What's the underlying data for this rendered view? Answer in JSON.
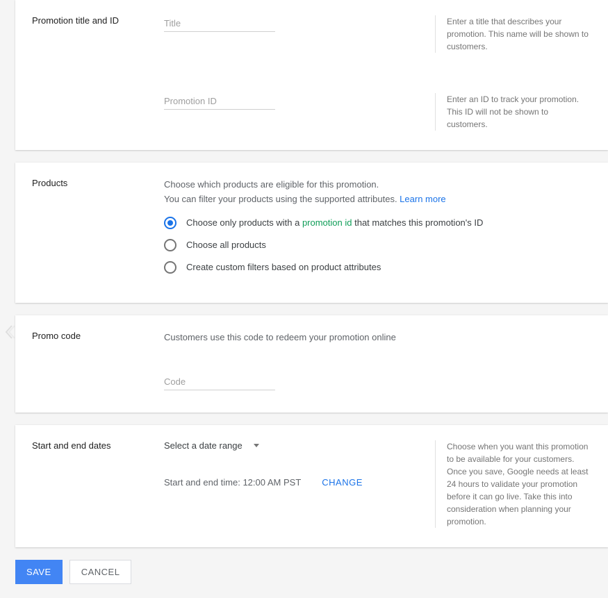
{
  "title_section": {
    "label": "Promotion title and ID",
    "title_placeholder": "Title",
    "title_help": "Enter a title that describes your promotion. This name will be shown to customers.",
    "id_placeholder": "Promotion ID",
    "id_help": "Enter an ID to track your promotion. This ID will not be shown to customers."
  },
  "products_section": {
    "label": "Products",
    "desc_line1": "Choose which products are eligible for this promotion.",
    "desc_line2_a": "You can filter your products using the supported attributes. ",
    "learn_more": "Learn more",
    "options": [
      {
        "label_before": "Choose only products with a ",
        "green": "promotion id",
        "label_after": " that matches this promotion's ID",
        "checked": true
      },
      {
        "label_before": "Choose all products",
        "green": "",
        "label_after": "",
        "checked": false
      },
      {
        "label_before": "Create custom filters based on product attributes",
        "green": "",
        "label_after": "",
        "checked": false
      }
    ]
  },
  "promo_section": {
    "label": "Promo code",
    "desc": "Customers use this code to redeem your promotion online",
    "code_placeholder": "Code"
  },
  "dates_section": {
    "label": "Start and end dates",
    "select_label": "Select a date range",
    "time_label": "Start and end time: ",
    "time_value": "12:00 AM PST",
    "change": "CHANGE",
    "help": "Choose when you want this promotion to be available for your customers. Once you save, Google needs at least 24 hours to validate your promotion before it can go live. Take this into consideration when planning your promotion."
  },
  "actions": {
    "save": "SAVE",
    "cancel": "CANCEL"
  }
}
